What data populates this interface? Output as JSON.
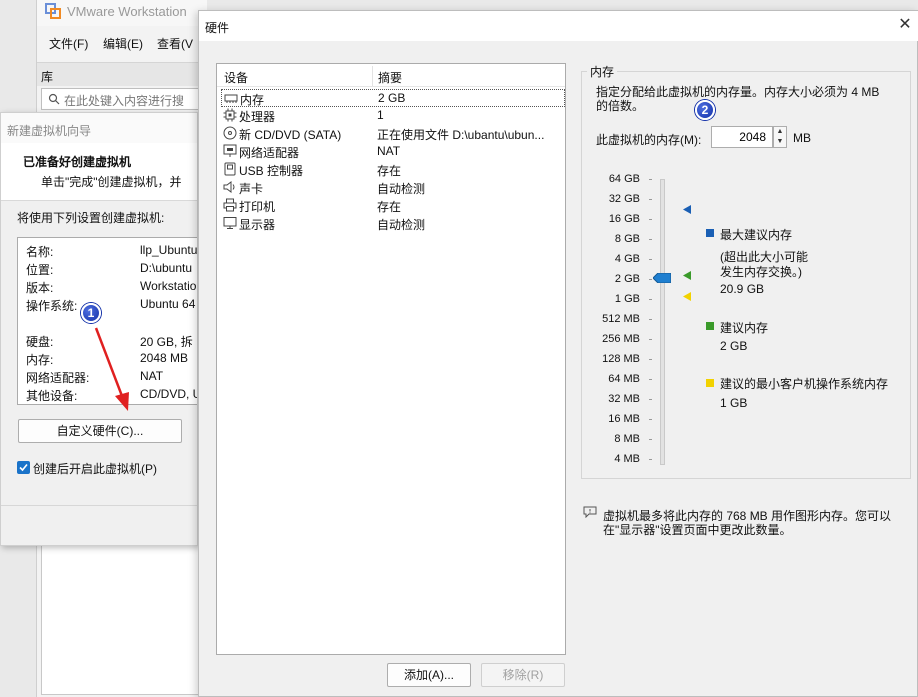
{
  "vmware": {
    "title": "VMware Workstation",
    "menus": [
      "文件(F)",
      "编辑(E)",
      "查看(V"
    ],
    "library_label": "库",
    "search_placeholder": "在此处键入内容进行搜"
  },
  "wizard": {
    "title": "新建虚拟机向导",
    "heading": "已准备好创建虚拟机",
    "subheading": "单击\"完成\"创建虚拟机，并",
    "intro": "将使用下列设置创建虚拟机:",
    "summary": [
      {
        "key": "名称:",
        "value": "llp_Ubuntu"
      },
      {
        "key": "位置:",
        "value": "D:\\ubuntu"
      },
      {
        "key": "版本:",
        "value": "Workstation"
      },
      {
        "key": "操作系统:",
        "value": "Ubuntu 64"
      },
      {
        "key": "",
        "value": ""
      },
      {
        "key": "硬盘:",
        "value": "20 GB, 拆"
      },
      {
        "key": "内存:",
        "value": "2048 MB"
      },
      {
        "key": "网络适配器:",
        "value": "NAT"
      },
      {
        "key": "其他设备:",
        "value": "CD/DVD, U"
      }
    ],
    "customize_button": "自定义硬件(C)...",
    "power_on_label": "创建后开启此虚拟机(P)",
    "power_on_checked": true
  },
  "badges": {
    "one": "1",
    "two": "2"
  },
  "hardware": {
    "title": "硬件",
    "close_glyph": "✕",
    "columns": {
      "device": "设备",
      "summary": "摘要"
    },
    "devices": [
      {
        "name": "内存",
        "summary": "2 GB",
        "icon": "memory-icon",
        "selected": true
      },
      {
        "name": "处理器",
        "summary": "1",
        "icon": "cpu-icon",
        "selected": false
      },
      {
        "name": "新 CD/DVD (SATA)",
        "summary": "正在使用文件 D:\\ubantu\\ubun...",
        "icon": "cd-icon",
        "selected": false
      },
      {
        "name": "网络适配器",
        "summary": "NAT",
        "icon": "network-icon",
        "selected": false
      },
      {
        "name": "USB 控制器",
        "summary": "存在",
        "icon": "usb-icon",
        "selected": false
      },
      {
        "name": "声卡",
        "summary": "自动检测",
        "icon": "sound-icon",
        "selected": false
      },
      {
        "name": "打印机",
        "summary": "存在",
        "icon": "printer-icon",
        "selected": false
      },
      {
        "name": "显示器",
        "summary": "自动检测",
        "icon": "display-icon",
        "selected": false
      }
    ],
    "add_button": "添加(A)...",
    "remove_button": "移除(R)"
  },
  "memory": {
    "group_title": "内存",
    "description_line1": "指定分配给此虚拟机的内存量。内存大小必须为 4 MB",
    "description_line2": "的倍数。",
    "field_label": "此虚拟机的内存(M):",
    "value": "2048",
    "unit": "MB",
    "scale_labels": [
      "64 GB",
      "32 GB",
      "16 GB",
      "8 GB",
      "4 GB",
      "2 GB",
      "1 GB",
      "512 MB",
      "256 MB",
      "128 MB",
      "64 MB",
      "32 MB",
      "16 MB",
      "8 MB",
      "4 MB"
    ],
    "legend": {
      "max": {
        "label": "最大建议内存",
        "note1": "(超出此大小可能",
        "note2": "发生内存交换。)",
        "value": "20.9 GB",
        "color": "#1a5fb4"
      },
      "recommended": {
        "label": "建议内存",
        "value": "2 GB",
        "color": "#3a9a2a"
      },
      "min_guest": {
        "label": "建议的最小客户机操作系统内存",
        "value": "1 GB",
        "color": "#f2d200"
      }
    },
    "info_line1": "虚拟机最多将此内存的 768 MB 用作图形内存。您可以",
    "info_line2": "在\"显示器\"设置页面中更改此数量。"
  }
}
